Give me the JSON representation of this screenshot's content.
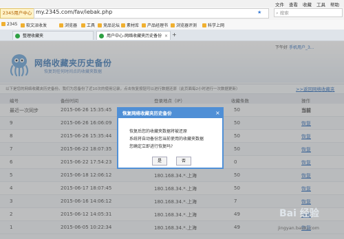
{
  "window_menu": [
    "文件",
    "查看",
    "收藏",
    "工具",
    "帮助"
  ],
  "address": {
    "badge": "2345用户中心",
    "url": "my.2345.com/fav/iebak.php",
    "search_placeholder": "搜索"
  },
  "bookmarks": [
    "2345",
    "软文派收发",
    "浏览器",
    "工具",
    "竞品论坛",
    "素材库",
    "产品经理书",
    "浏览器评测",
    "科学上网"
  ],
  "tabs": [
    {
      "label": "整理收藏夹",
      "active": false
    },
    {
      "label": "用户中心-网络收藏夹历史备份",
      "active": true
    }
  ],
  "new_tab_symbol": "+",
  "header": {
    "user_prefix": "下午好",
    "user_name": "手机用户_3...",
    "title": "网络收藏夹历史备份",
    "subtitle": "恢复到任何时间点的收藏夹数据"
  },
  "info": {
    "text": "以下是您的网络收藏夹历史备份。我们为您备份了近10次的使用记录，点击恢复按钮可以进行数据还原（此页面每2小时进行一次数据更新）",
    "back_link": ">>返回网络收藏夹"
  },
  "table": {
    "columns": [
      "编号",
      "备份时间",
      "登录地点（IP）",
      "收藏条数",
      "操作"
    ],
    "rows": [
      {
        "id": "最近一次同步",
        "time": "2015-06-26 15:35:45",
        "ip": "",
        "count": "50",
        "action": "当前"
      },
      {
        "id": "9",
        "time": "2015-06-26 16:06:09",
        "ip": "",
        "count": "50",
        "action": "恢复"
      },
      {
        "id": "8",
        "time": "2015-06-26 15:35:44",
        "ip": "",
        "count": "50",
        "action": "恢复"
      },
      {
        "id": "7",
        "time": "2015-06-22 18:07:35",
        "ip": "",
        "count": "50",
        "action": "恢复"
      },
      {
        "id": "6",
        "time": "2015-06-22 17:54:23",
        "ip": "",
        "count": "0",
        "action": "恢复"
      },
      {
        "id": "5",
        "time": "2015-06-18 12:06:12",
        "ip": "180.168.34.*.上海",
        "count": "50",
        "action": "恢复"
      },
      {
        "id": "4",
        "time": "2015-06-17 18:07:45",
        "ip": "180.168.34.*.上海",
        "count": "50",
        "action": "恢复"
      },
      {
        "id": "3",
        "time": "2015-06-16 14:06:12",
        "ip": "180.168.34.*.上海",
        "count": "7",
        "action": "恢复"
      },
      {
        "id": "2",
        "time": "2015-06-12 14:05:31",
        "ip": "180.168.34.*.上海",
        "count": "49",
        "action": "恢复"
      },
      {
        "id": "1",
        "time": "2015-06-05 10:22:34",
        "ip": "180.168.34.*.上海",
        "count": "49",
        "action": "恢复"
      }
    ]
  },
  "dialog": {
    "title": "恢复网络收藏夹历史备份",
    "close": "×",
    "lines": [
      "恢复后您的收藏夹数据将被还原",
      "系统将自动备份您当前使用的收藏夹数据",
      "您确定立即进行恢复吗?"
    ],
    "yes": "是",
    "no": "否"
  },
  "watermark": {
    "brand": "Bai 经验",
    "site": "jingyan.baidu.com"
  },
  "colors": {
    "accent": "#4f8fd6",
    "link": "#1a5fb4"
  }
}
